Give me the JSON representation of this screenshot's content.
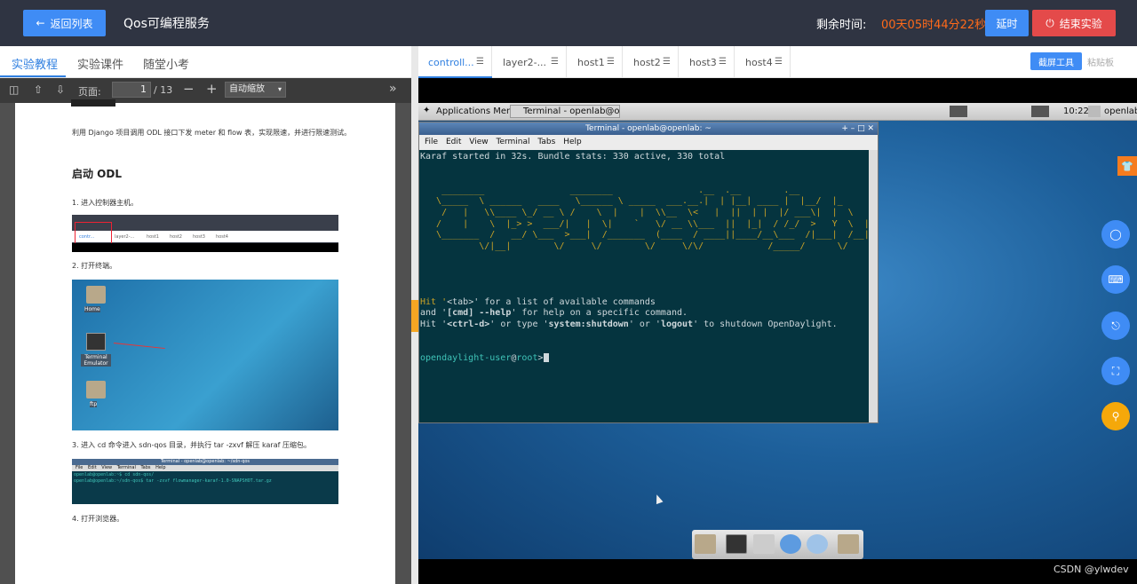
{
  "header": {
    "back_label": "返回列表",
    "title": "Qos可编程服务",
    "timer_label": "剩余时间:",
    "timer_value": "00天05时44分22秒",
    "delay_label": "延时",
    "end_label": "结束实验"
  },
  "left_tabs": [
    "实验教程",
    "实验课件",
    "随堂小考"
  ],
  "pdf_toolbar": {
    "page_label": "页面:",
    "page_current": "1",
    "page_total": "/ 13",
    "zoom": "自动缩放"
  },
  "doc": {
    "intro": "利用 Django 项目调用 ODL 接口下发 meter 和 flow 表，实现限速，并进行限速测试。",
    "heading": "启动 ODL",
    "steps": [
      "1.   进入控制器主机。",
      "2.   打开终端。",
      "3.   进入 cd 命令进入 sdn-qos 目录，并执行 tar -zxvf 解压 karaf 压缩包。",
      "4.   打开浏览器。"
    ],
    "fig1_tabs": [
      "contr...",
      "layer2-...",
      "host1",
      "host2",
      "host3",
      "host4"
    ],
    "fig2_icons": [
      "Home",
      "Terminal Emulator",
      "ftp"
    ],
    "fig3_title": "Terminal - openlab@openlab: ~/sdn-qos",
    "fig3_menu": [
      "File",
      "Edit",
      "View",
      "Terminal",
      "Tabs",
      "Help"
    ],
    "fig3_lines": [
      "openlab@openlab:~$ cd sdn-qos/",
      "openlab@openlab:~/sdn-qos$ tar -zxvf flowmanager-karaf-1.0-SNAPSHOT.tar.gz"
    ]
  },
  "right_tabs": [
    "controll...",
    "layer2-...",
    "host1",
    "host2",
    "host3",
    "host4"
  ],
  "right_tools": {
    "screenshot": "截屏工具",
    "paste": "粘贴板"
  },
  "vm": {
    "apps_menu": "Applications Menu",
    "taskbar_item": "Terminal - openlab@ope...",
    "clock": "10:22",
    "user": "openlab",
    "term_title": "Terminal - openlab@openlab: ~",
    "term_menu": [
      "File",
      "Edit",
      "View",
      "Terminal",
      "Tabs",
      "Help"
    ],
    "term_line1": "Karaf started in 32s. Bundle stats: 330 active, 330 total",
    "ascii": [
      "    ________                ________                .__  .__        .__",
      "   \\_____  \\ ______   ____   \\______ \\ _____  ___.__.|  | |__| ____ |  |__/  |_",
      "    /   |   \\\\____ \\_/ __ \\ /    \\  |    |  \\\\__  \\<   |  ||  | |  |/ ___\\|  |  \\   __\\",
      "   /    |    \\  |_> >  ___/|   |  \\|    `   \\/ __ \\\\___  ||  |_|  / /_/  >   Y  \\  |",
      "   \\_______  /   __/ \\___  >___|  /_______  (____  / ____||____/__\\___  /|___|  /__|",
      "           \\/|__|        \\/     \\/        \\/     \\/\\/            /_____/      \\/"
    ],
    "help1_a": "Hit '",
    "help1_b": "<tab>",
    "help1_c": "' for a list of available commands",
    "help2_a": "and '",
    "help2_b": "[cmd] --help",
    "help2_c": "' for help on a specific command.",
    "help3_a": "Hit '",
    "help3_b": "<ctrl-d>",
    "help3_c": "' or type '",
    "help3_d": "system:shutdown",
    "help3_e": "' or '",
    "help3_f": "logout",
    "help3_g": "' to shutdown OpenDaylight.",
    "prompt_user": "opendaylight-user",
    "prompt_at": "@",
    "prompt_host": "root",
    "prompt_end": ">"
  },
  "credit": "CSDN @ylwdev",
  "colors": {
    "primary": "#3f8cf5",
    "danger": "#e44a4a",
    "timer": "#ff6a1a",
    "topbar": "#2f3442"
  }
}
